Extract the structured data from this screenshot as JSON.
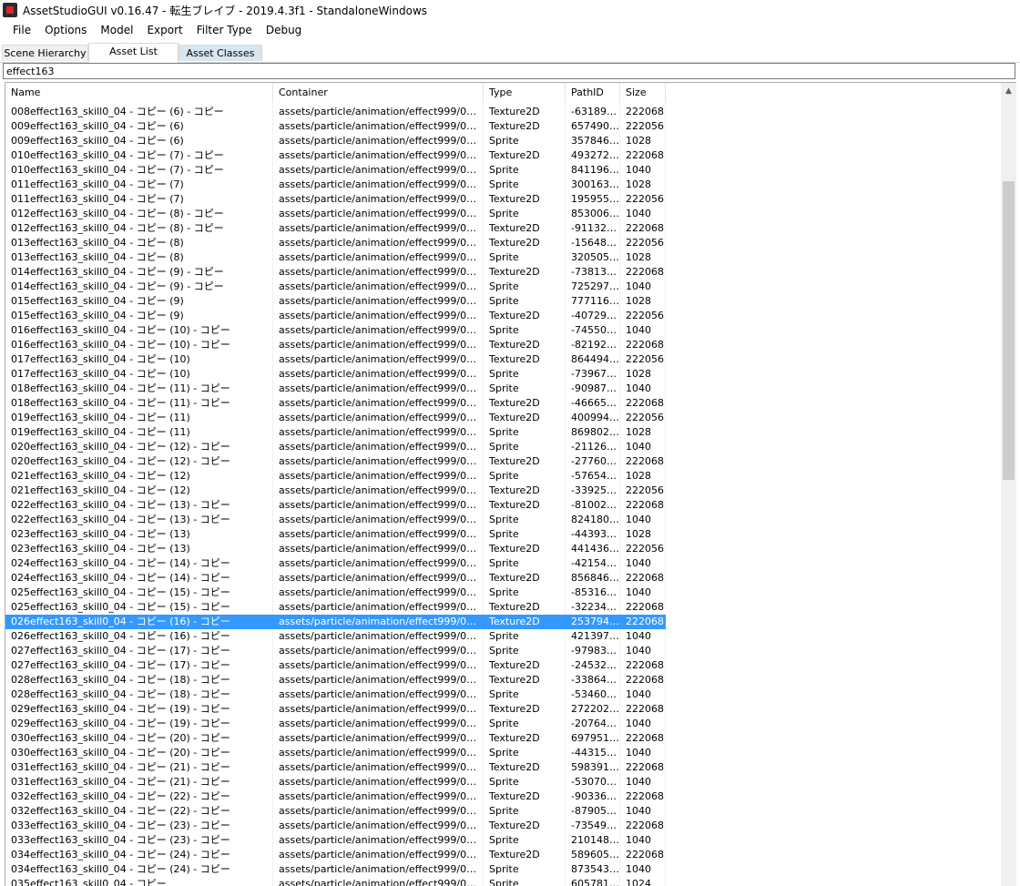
{
  "window": {
    "title": "AssetStudioGUI v0.16.47 - 転生ブレイブ - 2019.4.3f1 - StandaloneWindows"
  },
  "menu": [
    "File",
    "Options",
    "Model",
    "Export",
    "Filter Type",
    "Debug"
  ],
  "tabs": [
    "Scene Hierarchy",
    "Asset List",
    "Asset Classes"
  ],
  "active_tab": "Asset List",
  "filter": {
    "value": "effect163"
  },
  "columns": [
    "Name",
    "Container",
    "Type",
    "PathID",
    "Size"
  ],
  "selected_row_index": 35,
  "rows": [
    [
      "008effect163_skill0_04 - コピー (6) - コピー",
      "assets/particle/animation/effect999/008...",
      "Texture2D",
      "-631895...",
      "222068"
    ],
    [
      "009effect163_skill0_04 - コピー (6)",
      "assets/particle/animation/effect999/009...",
      "Texture2D",
      "6574909...",
      "222056"
    ],
    [
      "009effect163_skill0_04 - コピー (6)",
      "assets/particle/animation/effect999/009...",
      "Sprite",
      "3578460...",
      "1028"
    ],
    [
      "010effect163_skill0_04 - コピー (7) - コピー",
      "assets/particle/animation/effect999/010...",
      "Texture2D",
      "4932721...",
      "222068"
    ],
    [
      "010effect163_skill0_04 - コピー (7) - コピー",
      "assets/particle/animation/effect999/010...",
      "Sprite",
      "8411961...",
      "1040"
    ],
    [
      "011effect163_skill0_04 - コピー (7)",
      "assets/particle/animation/effect999/011...",
      "Sprite",
      "3001632...",
      "1028"
    ],
    [
      "011effect163_skill0_04 - コピー (7)",
      "assets/particle/animation/effect999/011...",
      "Texture2D",
      "1959554...",
      "222056"
    ],
    [
      "012effect163_skill0_04 - コピー (8) - コピー",
      "assets/particle/animation/effect999/012...",
      "Sprite",
      "8530061...",
      "1040"
    ],
    [
      "012effect163_skill0_04 - コピー (8) - コピー",
      "assets/particle/animation/effect999/012...",
      "Texture2D",
      "-911324...",
      "222068"
    ],
    [
      "013effect163_skill0_04 - コピー (8)",
      "assets/particle/animation/effect999/013...",
      "Texture2D",
      "-156483...",
      "222056"
    ],
    [
      "013effect163_skill0_04 - コピー (8)",
      "assets/particle/animation/effect999/013...",
      "Sprite",
      "3205050...",
      "1028"
    ],
    [
      "014effect163_skill0_04 - コピー (9) - コピー",
      "assets/particle/animation/effect999/014...",
      "Texture2D",
      "-738139...",
      "222068"
    ],
    [
      "014effect163_skill0_04 - コピー (9) - コピー",
      "assets/particle/animation/effect999/014...",
      "Sprite",
      "7252977...",
      "1040"
    ],
    [
      "015effect163_skill0_04 - コピー (9)",
      "assets/particle/animation/effect999/015...",
      "Sprite",
      "7771160...",
      "1028"
    ],
    [
      "015effect163_skill0_04 - コピー (9)",
      "assets/particle/animation/effect999/015...",
      "Texture2D",
      "-407299...",
      "222056"
    ],
    [
      "016effect163_skill0_04 - コピー (10) - コピー",
      "assets/particle/animation/effect999/016...",
      "Sprite",
      "-745500...",
      "1040"
    ],
    [
      "016effect163_skill0_04 - コピー (10) - コピー",
      "assets/particle/animation/effect999/016...",
      "Texture2D",
      "-821921...",
      "222068"
    ],
    [
      "017effect163_skill0_04 - コピー (10)",
      "assets/particle/animation/effect999/017...",
      "Texture2D",
      "8644943...",
      "222056"
    ],
    [
      "017effect163_skill0_04 - コピー (10)",
      "assets/particle/animation/effect999/017...",
      "Sprite",
      "-739678...",
      "1028"
    ],
    [
      "018effect163_skill0_04 - コピー (11) - コピー",
      "assets/particle/animation/effect999/018...",
      "Sprite",
      "-909878...",
      "1040"
    ],
    [
      "018effect163_skill0_04 - コピー (11) - コピー",
      "assets/particle/animation/effect999/018...",
      "Texture2D",
      "-466656...",
      "222068"
    ],
    [
      "019effect163_skill0_04 - コピー (11)",
      "assets/particle/animation/effect999/019...",
      "Texture2D",
      "4009949...",
      "222056"
    ],
    [
      "019effect163_skill0_04 - コピー (11)",
      "assets/particle/animation/effect999/019...",
      "Sprite",
      "8698029...",
      "1028"
    ],
    [
      "020effect163_skill0_04 - コピー (12) - コピー",
      "assets/particle/animation/effect999/020...",
      "Sprite",
      "-211268...",
      "1040"
    ],
    [
      "020effect163_skill0_04 - コピー (12) - コピー",
      "assets/particle/animation/effect999/020...",
      "Texture2D",
      "-277608...",
      "222068"
    ],
    [
      "021effect163_skill0_04 - コピー (12)",
      "assets/particle/animation/effect999/021...",
      "Sprite",
      "-576546...",
      "1028"
    ],
    [
      "021effect163_skill0_04 - コピー (12)",
      "assets/particle/animation/effect999/021...",
      "Texture2D",
      "-339258...",
      "222056"
    ],
    [
      "022effect163_skill0_04 - コピー (13) - コピー",
      "assets/particle/animation/effect999/022...",
      "Texture2D",
      "-810022...",
      "222068"
    ],
    [
      "022effect163_skill0_04 - コピー (13) - コピー",
      "assets/particle/animation/effect999/022...",
      "Sprite",
      "8241804...",
      "1040"
    ],
    [
      "023effect163_skill0_04 - コピー (13)",
      "assets/particle/animation/effect999/023...",
      "Sprite",
      "-443930...",
      "1028"
    ],
    [
      "023effect163_skill0_04 - コピー (13)",
      "assets/particle/animation/effect999/023...",
      "Texture2D",
      "4414362...",
      "222056"
    ],
    [
      "024effect163_skill0_04 - コピー (14) - コピー",
      "assets/particle/animation/effect999/024...",
      "Sprite",
      "-421543...",
      "1040"
    ],
    [
      "024effect163_skill0_04 - コピー (14) - コピー",
      "assets/particle/animation/effect999/024...",
      "Texture2D",
      "8568467...",
      "222068"
    ],
    [
      "025effect163_skill0_04 - コピー (15) - コピー",
      "assets/particle/animation/effect999/025...",
      "Sprite",
      "-853160...",
      "1040"
    ],
    [
      "025effect163_skill0_04 - コピー (15) - コピー",
      "assets/particle/animation/effect999/025...",
      "Texture2D",
      "-322340...",
      "222068"
    ],
    [
      "026effect163_skill0_04 - コピー (16) - コピー",
      "assets/particle/animation/effect999/026...",
      "Texture2D",
      "2537942...",
      "222068"
    ],
    [
      "026effect163_skill0_04 - コピー (16) - コピー",
      "assets/particle/animation/effect999/026...",
      "Sprite",
      "4213979...",
      "1040"
    ],
    [
      "027effect163_skill0_04 - コピー (17) - コピー",
      "assets/particle/animation/effect999/027...",
      "Sprite",
      "-979836...",
      "1040"
    ],
    [
      "027effect163_skill0_04 - コピー (17) - コピー",
      "assets/particle/animation/effect999/027...",
      "Texture2D",
      "-245320...",
      "222068"
    ],
    [
      "028effect163_skill0_04 - コピー (18) - コピー",
      "assets/particle/animation/effect999/028...",
      "Texture2D",
      "-338647...",
      "222068"
    ],
    [
      "028effect163_skill0_04 - コピー (18) - コピー",
      "assets/particle/animation/effect999/028...",
      "Sprite",
      "-534601...",
      "1040"
    ],
    [
      "029effect163_skill0_04 - コピー (19) - コピー",
      "assets/particle/animation/effect999/029...",
      "Texture2D",
      "2722028...",
      "222068"
    ],
    [
      "029effect163_skill0_04 - コピー (19) - コピー",
      "assets/particle/animation/effect999/029...",
      "Sprite",
      "-207644...",
      "1040"
    ],
    [
      "030effect163_skill0_04 - コピー (20) - コピー",
      "assets/particle/animation/effect999/030...",
      "Texture2D",
      "6979510...",
      "222068"
    ],
    [
      "030effect163_skill0_04 - コピー (20) - コピー",
      "assets/particle/animation/effect999/030...",
      "Sprite",
      "-443150...",
      "1040"
    ],
    [
      "031effect163_skill0_04 - コピー (21) - コピー",
      "assets/particle/animation/effect999/031...",
      "Texture2D",
      "5983918...",
      "222068"
    ],
    [
      "031effect163_skill0_04 - コピー (21) - コピー",
      "assets/particle/animation/effect999/031...",
      "Sprite",
      "-530703...",
      "1040"
    ],
    [
      "032effect163_skill0_04 - コピー (22) - コピー",
      "assets/particle/animation/effect999/032...",
      "Texture2D",
      "-903360...",
      "222068"
    ],
    [
      "032effect163_skill0_04 - コピー (22) - コピー",
      "assets/particle/animation/effect999/032...",
      "Sprite",
      "-879055...",
      "1040"
    ],
    [
      "033effect163_skill0_04 - コピー (23) - コピー",
      "assets/particle/animation/effect999/033...",
      "Texture2D",
      "-735496...",
      "222068"
    ],
    [
      "033effect163_skill0_04 - コピー (23) - コピー",
      "assets/particle/animation/effect999/033...",
      "Sprite",
      "2101483...",
      "1040"
    ],
    [
      "034effect163_skill0_04 - コピー (24) - コピー",
      "assets/particle/animation/effect999/034...",
      "Texture2D",
      "5896050...",
      "222068"
    ],
    [
      "034effect163_skill0_04 - コピー (24) - コピー",
      "assets/particle/animation/effect999/034...",
      "Sprite",
      "8735432...",
      "1040"
    ],
    [
      "035effect163_skill0_04 - コピー",
      "assets/particle/animation/effect999/035...",
      "Sprite",
      "6057810...",
      "1024"
    ]
  ],
  "colors": {
    "selection": "#3399ff",
    "tab_classes_bg": "#d8e6f2"
  },
  "icons": {
    "app": "app-icon",
    "scroll_up": "chevron-up-icon"
  }
}
